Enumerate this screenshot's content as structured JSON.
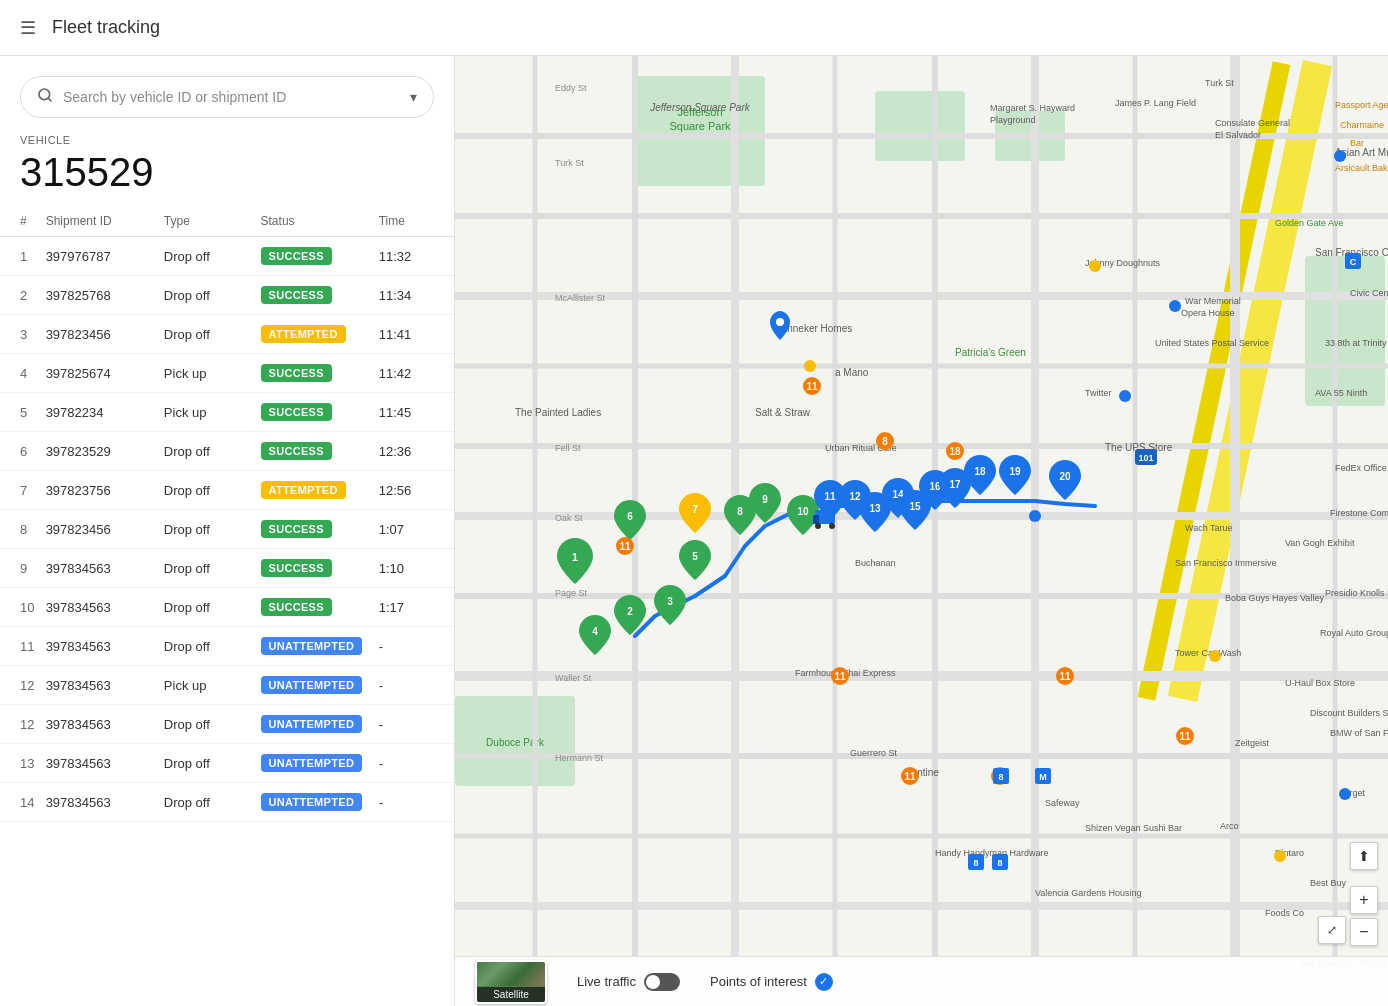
{
  "header": {
    "title": "Fleet tracking",
    "menu_icon": "☰"
  },
  "search": {
    "placeholder": "Search by vehicle ID or shipment ID"
  },
  "vehicle": {
    "label": "VEHICLE",
    "id": "315529"
  },
  "table": {
    "columns": [
      "#",
      "Shipment ID",
      "Type",
      "Status",
      "Time"
    ],
    "rows": [
      {
        "num": 1,
        "shipment_id": "397976787",
        "type": "Drop off",
        "status": "SUCCESS",
        "status_class": "badge-success",
        "time": "11:32"
      },
      {
        "num": 2,
        "shipment_id": "397825768",
        "type": "Drop off",
        "status": "SUCCESS",
        "status_class": "badge-success",
        "time": "11:34"
      },
      {
        "num": 3,
        "shipment_id": "397823456",
        "type": "Drop off",
        "status": "ATTEMPTED",
        "status_class": "badge-attempted",
        "time": "11:41"
      },
      {
        "num": 4,
        "shipment_id": "397825674",
        "type": "Pick up",
        "status": "SUCCESS",
        "status_class": "badge-success",
        "time": "11:42"
      },
      {
        "num": 5,
        "shipment_id": "39782234",
        "type": "Pick up",
        "status": "SUCCESS",
        "status_class": "badge-success",
        "time": "11:45"
      },
      {
        "num": 6,
        "shipment_id": "397823529",
        "type": "Drop off",
        "status": "SUCCESS",
        "status_class": "badge-success",
        "time": "12:36"
      },
      {
        "num": 7,
        "shipment_id": "397823756",
        "type": "Drop off",
        "status": "ATTEMPTED",
        "status_class": "badge-attempted",
        "time": "12:56"
      },
      {
        "num": 8,
        "shipment_id": "397823456",
        "type": "Drop off",
        "status": "SUCCESS",
        "status_class": "badge-success",
        "time": "1:07"
      },
      {
        "num": 9,
        "shipment_id": "397834563",
        "type": "Drop off",
        "status": "SUCCESS",
        "status_class": "badge-success",
        "time": "1:10"
      },
      {
        "num": 10,
        "shipment_id": "397834563",
        "type": "Drop off",
        "status": "SUCCESS",
        "status_class": "badge-success",
        "time": "1:17"
      },
      {
        "num": 11,
        "shipment_id": "397834563",
        "type": "Drop off",
        "status": "UNATTEMPTED",
        "status_class": "badge-unattempted",
        "time": "-"
      },
      {
        "num": 12,
        "shipment_id": "397834563",
        "type": "Pick up",
        "status": "UNATTEMPTED",
        "status_class": "badge-unattempted",
        "time": "-"
      },
      {
        "num": 12,
        "shipment_id": "397834563",
        "type": "Drop off",
        "status": "UNATTEMPTED",
        "status_class": "badge-unattempted",
        "time": "-"
      },
      {
        "num": 13,
        "shipment_id": "397834563",
        "type": "Drop off",
        "status": "UNATTEMPTED",
        "status_class": "badge-unattempted",
        "time": "-"
      },
      {
        "num": 14,
        "shipment_id": "397834563",
        "type": "Drop off",
        "status": "UNATTEMPTED",
        "status_class": "badge-unattempted",
        "time": "-"
      }
    ]
  },
  "map": {
    "satellite_label": "Satellite",
    "live_traffic_label": "Live traffic",
    "poi_label": "Points of interest",
    "zoom_in": "+",
    "zoom_out": "−"
  }
}
